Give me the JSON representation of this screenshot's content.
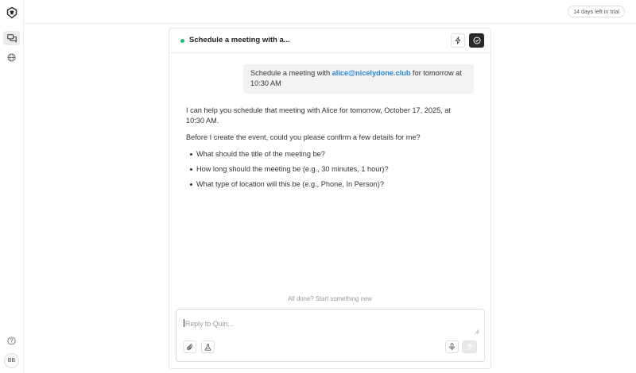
{
  "sidebar": {
    "logo": "app-logo-icon",
    "items": [
      {
        "icon": "chat-bubbles-icon",
        "active": true
      },
      {
        "icon": "globe-icon",
        "active": false
      }
    ],
    "help_icon": "help-circle-icon",
    "avatar_initials": "BB"
  },
  "topbar": {
    "trial_label": "14 days left in trial"
  },
  "panel": {
    "status_color": "#22b573",
    "title": "Schedule a meeting with a..."
  },
  "conversation": {
    "user_message": {
      "prefix": "Schedule a meeting with ",
      "email": "alice@nicelydone.club",
      "suffix": " for tomorrow at 10:30 AM"
    },
    "assistant": {
      "para1": "I can help you schedule that meeting with Alice for tomorrow, October 17, 2025, at 10:30 AM.",
      "para2": "Before I create the event, could you please confirm a few details for me?",
      "questions": [
        "What should the title of the meeting be?",
        "How long should the meeting be (e.g., 30 minutes, 1 hour)?",
        "What type of location will this be (e.g., Phone, In Person)?"
      ]
    }
  },
  "footer": {
    "all_done": "All done? Start something new"
  },
  "composer": {
    "placeholder": "Reply to Quin..."
  },
  "colors": {
    "accent_link": "#2a86d8",
    "dark_button": "#2a2a2a"
  }
}
